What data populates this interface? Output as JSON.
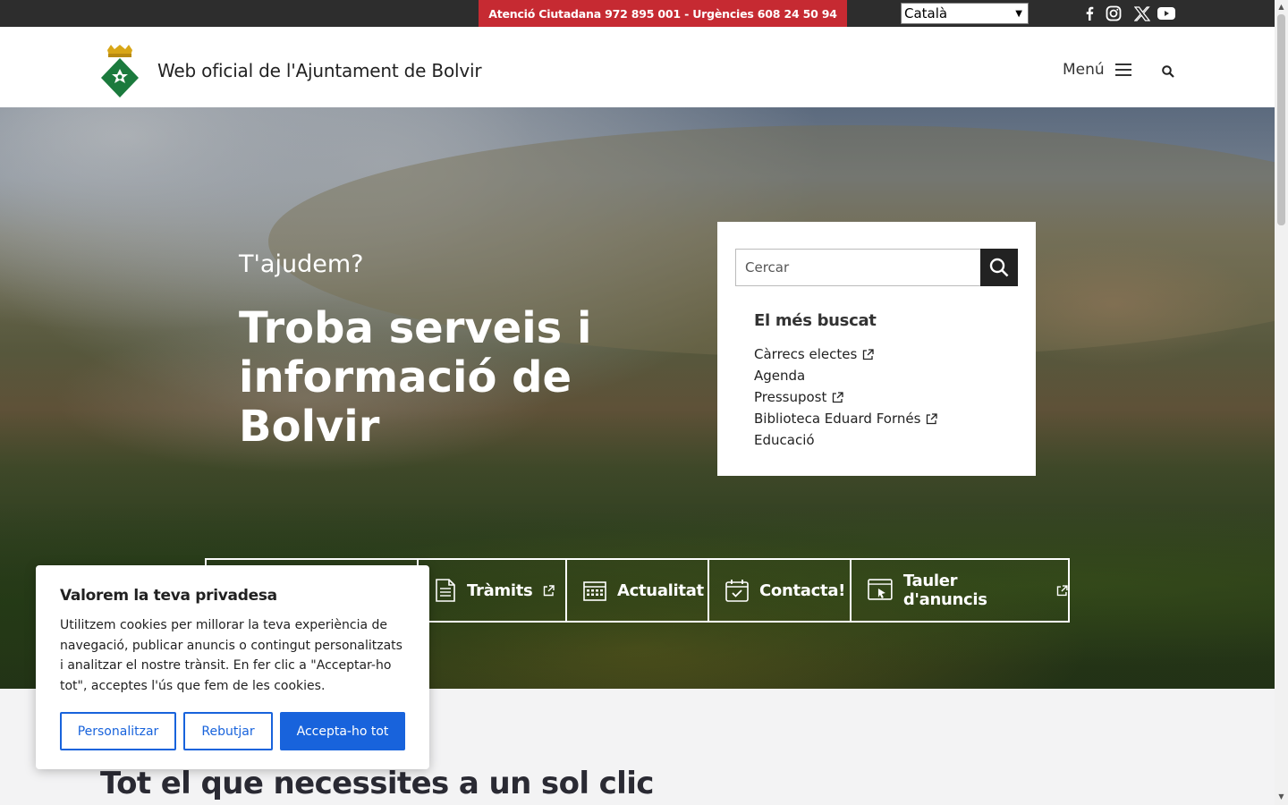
{
  "topbar": {
    "contact": "Atenció Ciutadana 972 895 001 - Urgències 608 24 50 94",
    "language": "Català",
    "social": [
      "facebook-icon",
      "instagram-icon",
      "x-icon",
      "youtube-icon"
    ]
  },
  "header": {
    "site_title": "Web oficial de l'Ajuntament de Bolvir",
    "menu_label": "Menú"
  },
  "hero": {
    "kicker": "T'ajudem?",
    "title": "Troba serveis i informació de Bolvir"
  },
  "search": {
    "placeholder": "Cercar",
    "popular_title": "El més buscat",
    "popular": [
      {
        "label": "Càrrecs electes",
        "external": true
      },
      {
        "label": "Agenda",
        "external": false
      },
      {
        "label": "Pressupost",
        "external": true
      },
      {
        "label": "Biblioteca Eduard Fornés",
        "external": true
      },
      {
        "label": "Educació",
        "external": false
      }
    ]
  },
  "quick_links": [
    {
      "label": "",
      "icon": ""
    },
    {
      "label": "Tràmits",
      "icon": "document-icon",
      "external": true
    },
    {
      "label": "Actualitat",
      "icon": "calendar-grid-icon",
      "external": false
    },
    {
      "label": "Contacta!",
      "icon": "calendar-check-icon",
      "external": false
    },
    {
      "label": "Tauler d'anuncis",
      "icon": "board-click-icon",
      "external": true
    }
  ],
  "cookie": {
    "title": "Valorem la teva privadesa",
    "text": "Utilitzem cookies per millorar la teva experiència de navegació, publicar anuncis o contingut personalitzats i analitzar el nostre trànsit. En fer clic a \"Acceptar-ho tot\", acceptes l'ús que fem de les cookies.",
    "customize": "Personalitzar",
    "reject": "Rebutjar",
    "accept": "Accepta-ho tot"
  },
  "section": {
    "title": "Tot el que necessites a un sol clic"
  },
  "colors": {
    "accent_red": "#c62a32",
    "topbar_bg": "#2d2d2d",
    "cookie_blue": "#1863dc"
  }
}
